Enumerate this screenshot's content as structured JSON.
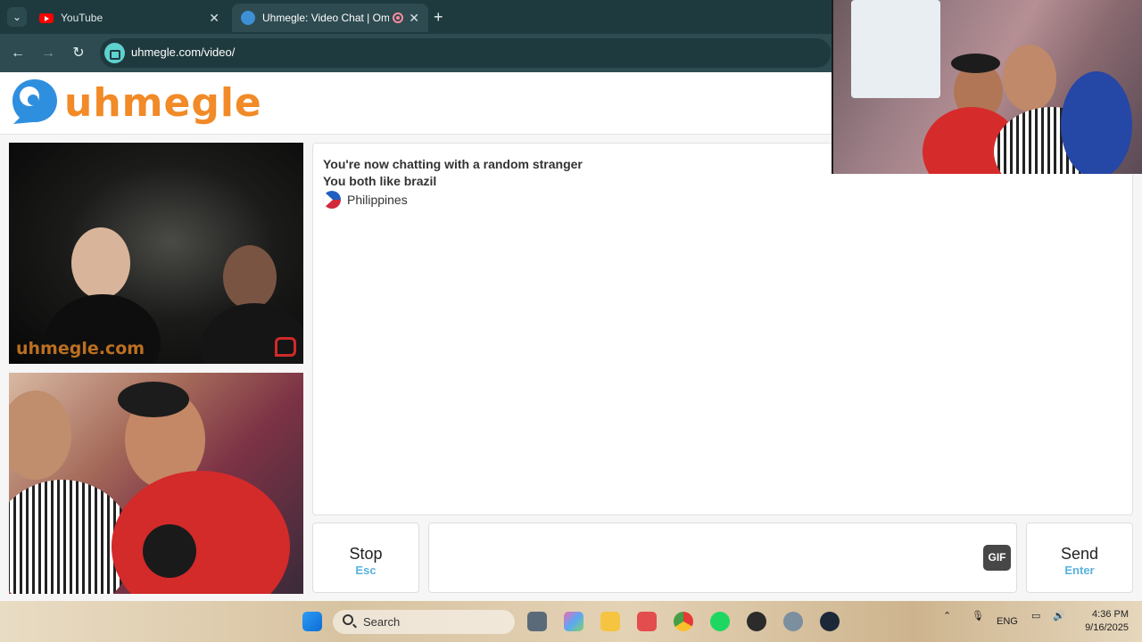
{
  "browser": {
    "tabs": [
      {
        "label": "YouTube",
        "icon": "youtube-icon"
      },
      {
        "label": "Uhmegle: Video Chat | Ome",
        "icon": "uhmegle-favicon-icon",
        "recording": true
      }
    ],
    "address": "uhmegle.com/video/"
  },
  "site": {
    "logo_text": "uhmegle",
    "logo_color": "#f18a27",
    "accent_color": "#5ab3dc"
  },
  "stranger_video": {
    "watermark": "uhmegle.com"
  },
  "chat": {
    "lines": [
      "You're now chatting with a random stranger",
      "You both like brazil"
    ],
    "country": "Philippines"
  },
  "controls": {
    "stop_label": "Stop",
    "stop_hint": "Esc",
    "gif_label": "GIF",
    "send_label": "Send",
    "send_hint": "Enter"
  },
  "taskbar": {
    "search_label": "Search",
    "language": "ENG",
    "time": "4:36 PM",
    "date": "9/16/2025"
  }
}
